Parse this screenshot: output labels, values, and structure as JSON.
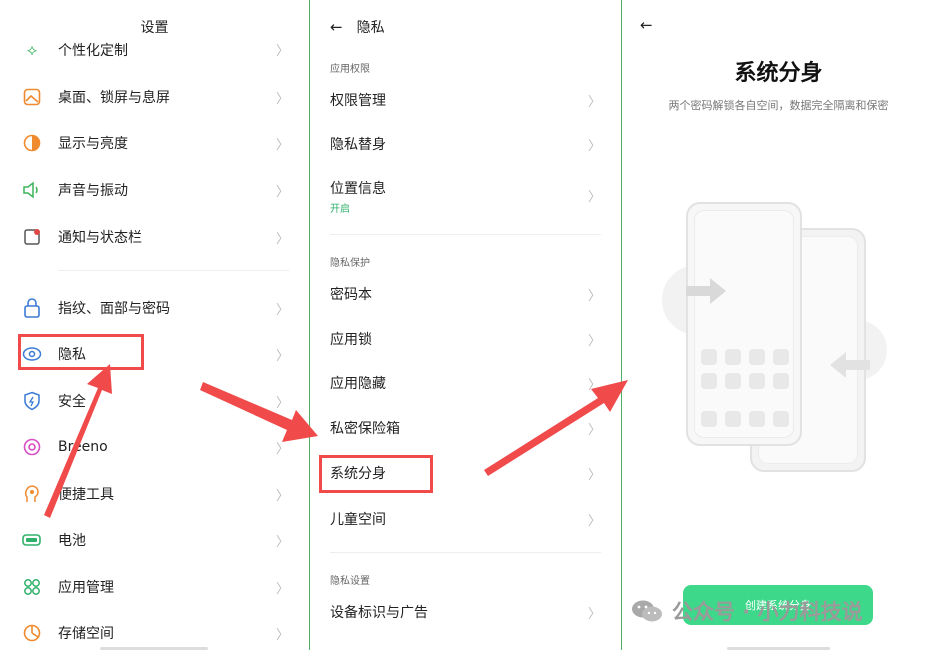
{
  "panel1": {
    "title": "设置",
    "items": [
      {
        "label": "个性化定制",
        "icon": "personalize-icon",
        "color": "#3cb35c"
      },
      {
        "label": "桌面、锁屏与息屏",
        "icon": "wallpaper-icon",
        "color": "#f08a2e"
      },
      {
        "label": "显示与亮度",
        "icon": "brightness-icon",
        "color": "#f08a2e"
      },
      {
        "label": "声音与振动",
        "icon": "speaker-icon",
        "color": "#3cb35c"
      },
      {
        "label": "通知与状态栏",
        "icon": "notification-icon",
        "color": "#e04848"
      },
      {
        "label": "指纹、面部与密码",
        "icon": "lock-icon",
        "color": "#3a7bd5"
      },
      {
        "label": "隐私",
        "icon": "privacy-icon",
        "color": "#3a7bd5"
      },
      {
        "label": "安全",
        "icon": "shield-icon",
        "color": "#3a7bd5"
      },
      {
        "label": "Breeno",
        "icon": "breeno-icon",
        "color": "#d94fc3"
      },
      {
        "label": "便捷工具",
        "icon": "tools-icon",
        "color": "#f08a2e"
      },
      {
        "label": "电池",
        "icon": "battery-icon",
        "color": "#2fb06a"
      },
      {
        "label": "应用管理",
        "icon": "apps-icon",
        "color": "#2fb06a"
      },
      {
        "label": "存储空间",
        "icon": "storage-icon",
        "color": "#f08a2e"
      }
    ]
  },
  "panel2": {
    "title": "隐私",
    "sections": [
      {
        "header": "应用权限",
        "items": [
          {
            "label": "权限管理"
          },
          {
            "label": "隐私替身"
          },
          {
            "label": "位置信息",
            "sub": "开启"
          }
        ]
      },
      {
        "header": "隐私保护",
        "items": [
          {
            "label": "密码本"
          },
          {
            "label": "应用锁"
          },
          {
            "label": "应用隐藏"
          },
          {
            "label": "私密保险箱"
          },
          {
            "label": "系统分身"
          },
          {
            "label": "儿童空间"
          }
        ]
      },
      {
        "header": "隐私设置",
        "items": [
          {
            "label": "设备标识与广告"
          }
        ]
      }
    ]
  },
  "panel3": {
    "title": "系统分身",
    "description": "两个密码解锁各自空间，数据完全隔离和保密",
    "button": "创建系统分身"
  },
  "watermark": "公众号 · 小力科技说",
  "colors": {
    "accent": "#3ed88a",
    "highlight": "#f04a4a",
    "divider": "#4cb26a"
  }
}
